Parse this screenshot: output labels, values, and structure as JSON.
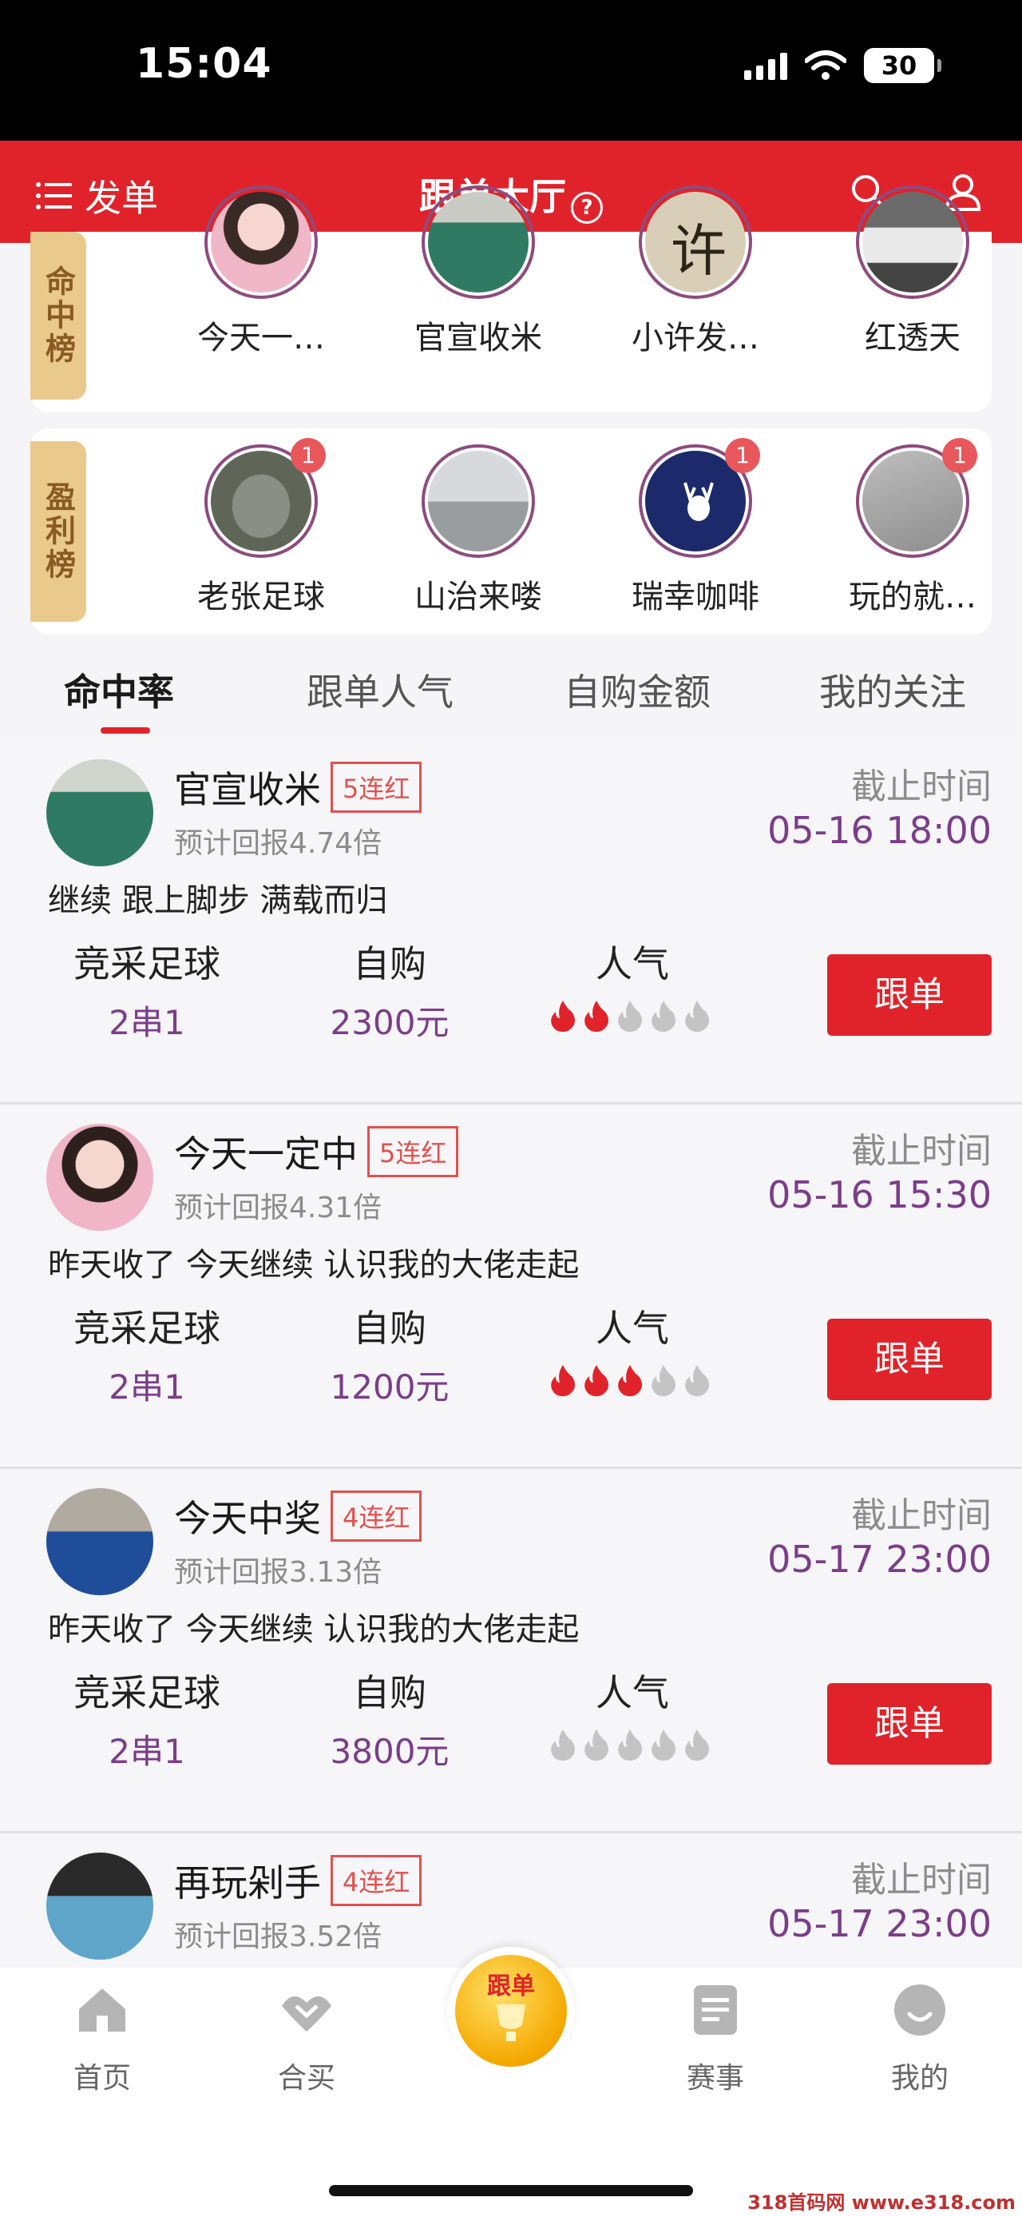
{
  "status_bar": {
    "time": "15:04",
    "battery": "30"
  },
  "header": {
    "left_label": "发单",
    "title": "跟单大厅",
    "help": "?"
  },
  "rank_hit": {
    "label": "命中榜",
    "items": [
      {
        "name": "今天一…",
        "badge": ""
      },
      {
        "name": "官宣收米",
        "badge": ""
      },
      {
        "name": "小许发…",
        "badge": ""
      },
      {
        "name": "红透天",
        "badge": ""
      }
    ]
  },
  "rank_profit": {
    "label": "盈利榜",
    "items": [
      {
        "name": "老张足球",
        "badge": "1"
      },
      {
        "name": "山治来喽",
        "badge": ""
      },
      {
        "name": "瑞幸咖啡",
        "badge": "1"
      },
      {
        "name": "玩的就…",
        "badge": "1"
      }
    ]
  },
  "tabs": [
    "命中率",
    "跟单人气",
    "自购金额",
    "我的关注"
  ],
  "cards": [
    {
      "name": "官宣收米",
      "streak": "5连红",
      "return": "预计回报4.74倍",
      "deadline_label": "截止时间",
      "deadline": "05-16 18:00",
      "desc": "继续 跟上脚步 满载而归",
      "col1_h": "竞采足球",
      "col1_v": "2串1",
      "col2_h": "自购",
      "col2_v": "2300元",
      "col3_h": "人气",
      "heat": 2,
      "button": "跟单"
    },
    {
      "name": "今天一定中",
      "streak": "5连红",
      "return": "预计回报4.31倍",
      "deadline_label": "截止时间",
      "deadline": "05-16 15:30",
      "desc": "昨天收了 今天继续 认识我的大佬走起",
      "col1_h": "竞采足球",
      "col1_v": "2串1",
      "col2_h": "自购",
      "col2_v": "1200元",
      "col3_h": "人气",
      "heat": 3,
      "button": "跟单"
    },
    {
      "name": "今天中奖",
      "streak": "4连红",
      "return": "预计回报3.13倍",
      "deadline_label": "截止时间",
      "deadline": "05-17 23:00",
      "desc": "昨天收了 今天继续 认识我的大佬走起",
      "col1_h": "竞采足球",
      "col1_v": "2串1",
      "col2_h": "自购",
      "col2_v": "3800元",
      "col3_h": "人气",
      "heat": 0,
      "button": "跟单"
    },
    {
      "name": "再玩剁手",
      "streak": "4连红",
      "return": "预计回报3.52倍",
      "deadline_label": "截止时间",
      "deadline": "05-17 23:00",
      "desc": "",
      "col1_h": "",
      "col1_v": "",
      "col2_h": "",
      "col2_v": "",
      "col3_h": "",
      "heat": 0,
      "button": ""
    }
  ],
  "bottom_nav": {
    "home": "首页",
    "group_buy": "合买",
    "center": "跟单",
    "matches": "赛事",
    "mine": "我的"
  },
  "watermark": "318首码网 www.e318.com",
  "colors": {
    "brand_red": "#e0232a",
    "accent_purple": "#7b3d8a",
    "rank_label_bg": "#e9c98c"
  }
}
